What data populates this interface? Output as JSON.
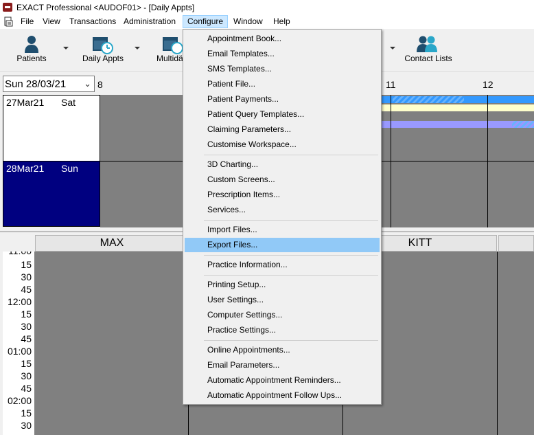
{
  "window": {
    "title": "EXACT Professional <AUDOF01> - [Daily Appts]"
  },
  "menubar": {
    "items": [
      "File",
      "View",
      "Transactions",
      "Administration",
      "Configure",
      "Window",
      "Help"
    ],
    "active": "Configure"
  },
  "toolbar": {
    "buttons": [
      {
        "label": "Patients",
        "icon": "patient-icon"
      },
      {
        "label": "Daily Appts",
        "icon": "daily-appts-icon"
      },
      {
        "label": "Multidä",
        "icon": "multiday-icon"
      },
      {
        "label": "Contact Lists",
        "icon": "contact-lists-icon"
      }
    ]
  },
  "datepicker": {
    "value": "Sun  28/03/21"
  },
  "hours": [
    "8",
    "11",
    "12"
  ],
  "week": {
    "rows": [
      {
        "date": "27Mar21",
        "day": "Sat",
        "selected": false
      },
      {
        "date": "28Mar21",
        "day": "Sun",
        "selected": true
      }
    ]
  },
  "columns": [
    "MAX",
    "KITT"
  ],
  "times": [
    "15",
    "30",
    "45",
    "12:00",
    "15",
    "30",
    "45",
    "01:00",
    "15",
    "30",
    "45",
    "02:00",
    "15",
    "30"
  ],
  "configure_menu": {
    "groups": [
      [
        "Appointment Book...",
        "Email Templates...",
        "SMS Templates...",
        "Patient File...",
        "Patient Payments...",
        "Patient Query Templates...",
        "Claiming Parameters...",
        "Customise Workspace..."
      ],
      [
        "3D Charting...",
        "Custom Screens...",
        "Prescription Items...",
        "Services..."
      ],
      [
        "Import Files...",
        "Export Files..."
      ],
      [
        "Practice Information..."
      ],
      [
        "Printing Setup...",
        "User Settings...",
        "Computer Settings...",
        "Practice Settings..."
      ],
      [
        "Online Appointments...",
        "Email Parameters...",
        "Automatic Appointment Reminders...",
        "Automatic Appointment Follow Ups..."
      ]
    ],
    "highlighted": "Export Files..."
  },
  "colors": {
    "selected_day": "#000080",
    "grid": "#808080",
    "bar_blue": "#3399ff",
    "bar_yellow": "#ffffcc",
    "bar_purple": "#9999ff",
    "menu_highlight": "#91c9f7"
  }
}
